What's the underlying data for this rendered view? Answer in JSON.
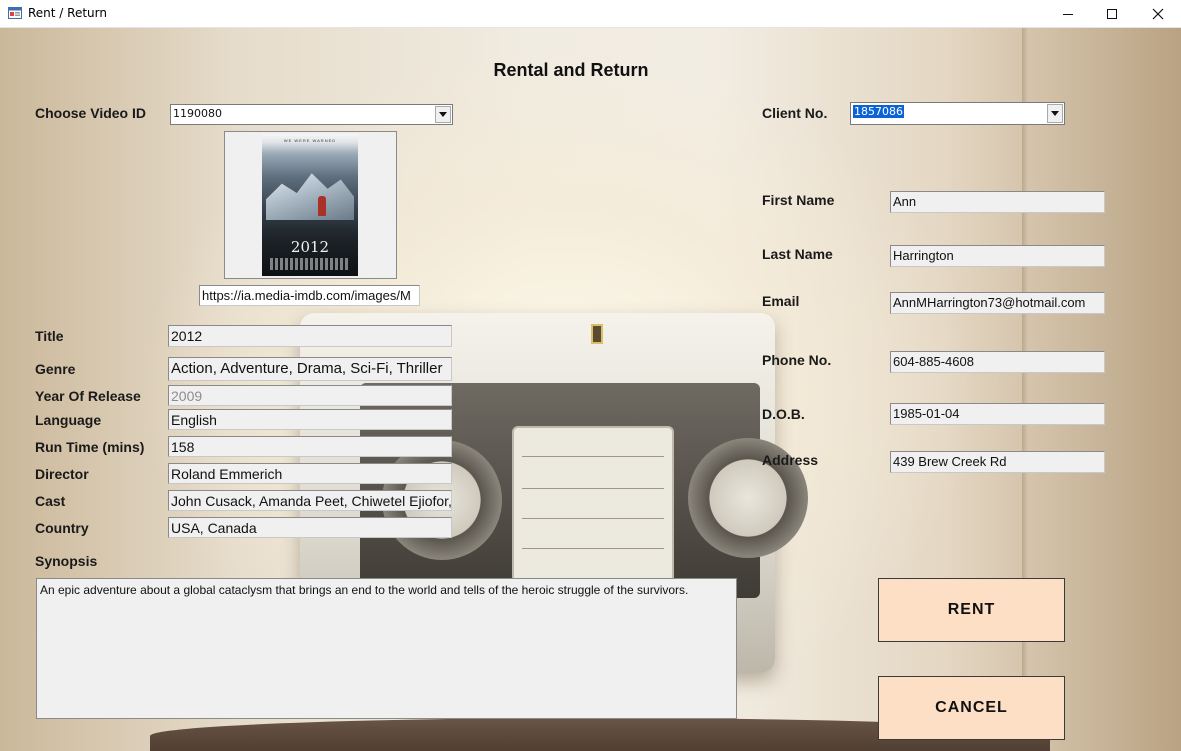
{
  "window": {
    "title": "Rent / Return",
    "minimize_glyph": "—",
    "maximize_glyph": "☐",
    "close_glyph": "✕"
  },
  "form": {
    "title": "Rental and Return"
  },
  "video": {
    "choose_label": "Choose Video ID",
    "video_id": "1190080",
    "poster": {
      "tagline": "WE WERE WARNED",
      "title": "2012"
    },
    "poster_url": "https://ia.media-imdb.com/images/M"
  },
  "details": {
    "title_label": "Title",
    "title_value": "2012",
    "genre_label": "Genre",
    "genre_value": "Action, Adventure, Drama, Sci-Fi, Thriller",
    "year_label": "Year Of Release",
    "year_value": "2009",
    "language_label": "Language",
    "language_value": "English",
    "runtime_label": "Run Time (mins)",
    "runtime_value": "158",
    "director_label": "Director",
    "director_value": "Roland Emmerich",
    "cast_label": "Cast",
    "cast_value": "John Cusack, Amanda Peet, Chiwetel Ejiofor, T",
    "country_label": "Country",
    "country_value": "USA, Canada",
    "synopsis_label": "Synopsis",
    "synopsis_value": "An epic adventure about a global cataclysm that brings an end to the world and tells of the heroic struggle of the survivors."
  },
  "client": {
    "client_no_label": "Client No.",
    "client_no": "1857086",
    "first_name_label": "First Name",
    "first_name": "Ann",
    "last_name_label": "Last Name",
    "last_name": "Harrington",
    "email_label": "Email",
    "email": "AnnMHarrington73@hotmail.com",
    "phone_label": "Phone No.",
    "phone": "604-885-4608",
    "dob_label": "D.O.B.",
    "dob": "1985-01-04",
    "address_label": "Address",
    "address": "439 Brew Creek Rd"
  },
  "actions": {
    "rent_label": "RENT",
    "cancel_label": "CANCEL"
  },
  "colors": {
    "button_bg": "#fddfc6",
    "selection": "#0a64d8",
    "field_bg": "#f0f0f0"
  },
  "icons": {
    "app": "window-form-icon",
    "dropdown": "chevron-down-icon"
  }
}
